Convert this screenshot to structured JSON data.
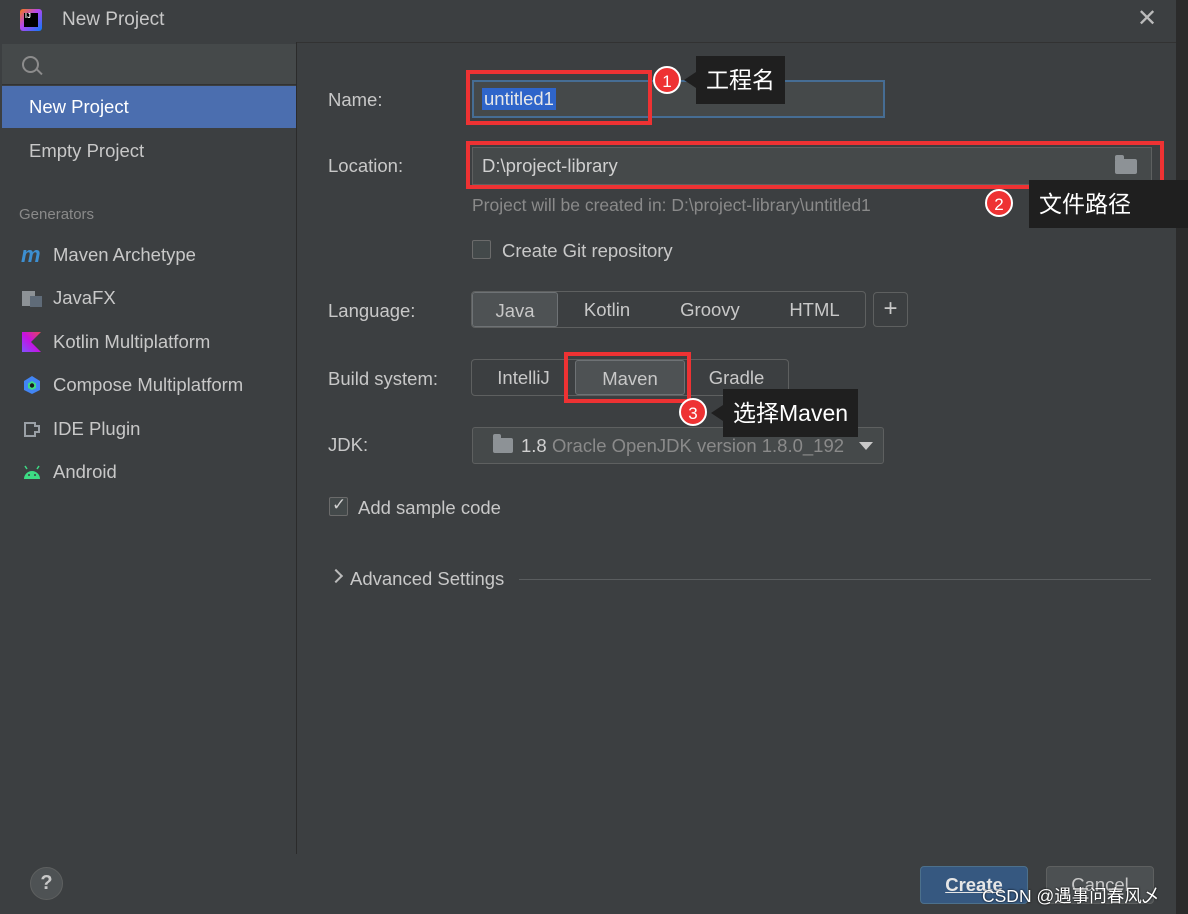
{
  "window": {
    "title": "New Project",
    "close_glyph": "✕",
    "app_icon_text": "IJ"
  },
  "sidebar": {
    "items": [
      {
        "label": "New Project",
        "selected": true
      },
      {
        "label": "Empty Project",
        "selected": false
      }
    ],
    "generators_label": "Generators",
    "generators": [
      {
        "label": "Maven Archetype",
        "icon": "maven-icon"
      },
      {
        "label": "JavaFX",
        "icon": "javafx-icon"
      },
      {
        "label": "Kotlin Multiplatform",
        "icon": "kotlin-icon"
      },
      {
        "label": "Compose Multiplatform",
        "icon": "compose-icon"
      },
      {
        "label": "IDE Plugin",
        "icon": "plugin-icon"
      },
      {
        "label": "Android",
        "icon": "android-icon"
      }
    ]
  },
  "form": {
    "name_label": "Name:",
    "name_value": "untitled1",
    "location_label": "Location:",
    "location_value": "D:\\project-library",
    "location_hint": "Project will be created in: D:\\project-library\\untitled1",
    "git_label": "Create Git repository",
    "git_checked": false,
    "language_label": "Language:",
    "languages": [
      "Java",
      "Kotlin",
      "Groovy",
      "HTML"
    ],
    "language_selected": "Java",
    "add_language_glyph": "+",
    "build_label": "Build system:",
    "build_systems": [
      "IntelliJ",
      "Maven",
      "Gradle"
    ],
    "build_selected": "Maven",
    "jdk_label": "JDK:",
    "jdk_version": "1.8",
    "jdk_desc": "Oracle OpenJDK version 1.8.0_192",
    "sample_label": "Add sample code",
    "sample_checked": true,
    "advanced_label": "Advanced Settings"
  },
  "footer": {
    "help_glyph": "?",
    "create_label": "Create",
    "cancel_label": "Cancel",
    "watermark": "CSDN @遇事问春风乄"
  },
  "annotations": [
    {
      "number": "1",
      "text": "工程名"
    },
    {
      "number": "2",
      "text": "文件路径"
    },
    {
      "number": "3",
      "text": "选择Maven"
    }
  ],
  "colors": {
    "background": "#3c3f41",
    "selection": "#4b6eaf",
    "annotation_red": "#ee3233",
    "primary_button": "#365880"
  }
}
